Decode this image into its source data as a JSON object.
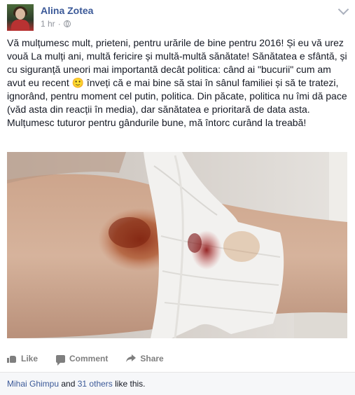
{
  "post": {
    "author": "Alina Zotea",
    "time": "1 hr",
    "separator": "·",
    "text": "Vă mulțumesc mult, prieteni, pentru urările de bine pentru 2016! Și eu vă urez vouă La mulți ani, multă fericire și multă-multă sănătate! Sănătatea e sfântă, și cu siguranță uneori mai importantă decât politica: când ai \"bucurii\" cum am avut eu recent 🙂 înveți că e mai bine să stai în sânul familiei și să te tratezi, ignorând, pentru moment cel putin, politica. Din păcate, politica nu îmi dă pace (văd asta din reacții în media), dar sănătatea e prioritară de data asta. Mulțumesc tuturor pentru gândurile bune, mă întorc curând la treabă!"
  },
  "actions": {
    "like": "Like",
    "comment": "Comment",
    "share": "Share"
  },
  "likes": {
    "person": "Mihai Ghimpu",
    "and": "and",
    "others": "31 others",
    "suffix": "like this."
  },
  "icons": {
    "avatar": "profile-photo",
    "privacy": "globe-icon",
    "menu": "chevron-down-icon",
    "like": "thumbs-up-icon",
    "comment": "comment-icon",
    "share": "share-arrow-icon"
  },
  "colors": {
    "link": "#3b5998",
    "meta": "#90949c",
    "action": "#7f7f7f",
    "footer_bg": "#f6f7f9"
  }
}
